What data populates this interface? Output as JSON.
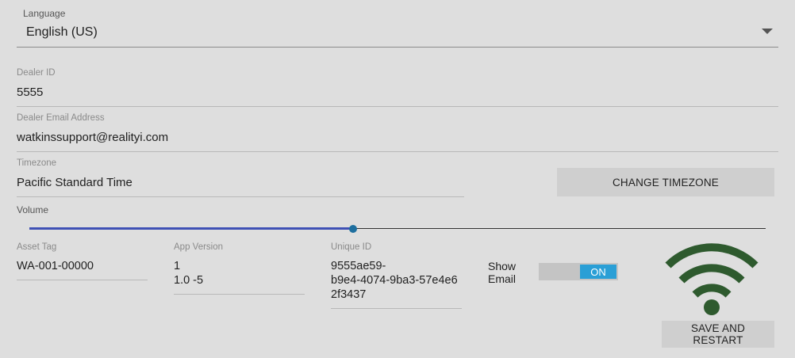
{
  "language": {
    "label": "Language",
    "value": "English (US)"
  },
  "dealer_id": {
    "label": "Dealer ID",
    "value": "5555"
  },
  "dealer_email": {
    "label": "Dealer Email Address",
    "value": "watkinssupport@realityi.com"
  },
  "timezone": {
    "label": "Timezone",
    "value": "Pacific Standard Time",
    "button_label": "CHANGE TIMEZONE"
  },
  "volume": {
    "label": "Volume",
    "level_fraction": 0.44
  },
  "asset_tag": {
    "label": "Asset Tag",
    "value": "WA-001-00000"
  },
  "app_version": {
    "label": "App Version",
    "line1": "1",
    "line2": "1.0 -5"
  },
  "unique_id": {
    "label": "Unique ID",
    "line1": "9555ae59-",
    "line2": "b9e4-4074-9ba3-57e4e6",
    "line3": "2f3437"
  },
  "show_email": {
    "label_line1": "Show",
    "label_line2": "Email",
    "toggle_text": "ON",
    "state": true
  },
  "wifi_icon": {
    "icon": "wifi-icon",
    "color": "#2e5a2e"
  },
  "save_button": {
    "label": "SAVE AND RESTART"
  },
  "colors": {
    "accent": "#3f51b5",
    "toggle_on": "#2a9fd6",
    "thumb": "#1e6f9f"
  }
}
